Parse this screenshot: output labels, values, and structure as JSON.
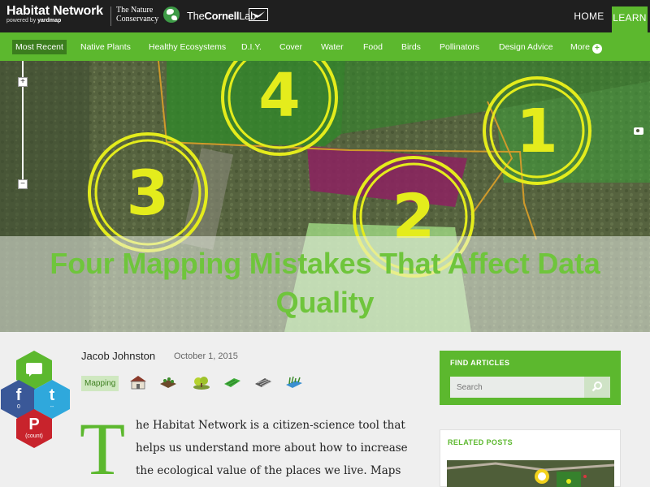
{
  "header": {
    "brand_title": "Habitat Network",
    "brand_sub_prefix": "powered by ",
    "brand_sub_bold": "yardmap",
    "partner1_line1": "The Nature",
    "partner1_line2": "Conservancy",
    "partner2_light": "The",
    "partner2_bold": "Cornell",
    "partner2_tail": "Lab",
    "nav": {
      "home": "HOME",
      "learn": "LEARN"
    }
  },
  "categories": [
    "Most Recent",
    "Native Plants",
    "Healthy Ecosystems",
    "D.I.Y.",
    "Cover",
    "Water",
    "Food",
    "Birds",
    "Pollinators",
    "Design Advice",
    "More"
  ],
  "categories_active": "Most Recent",
  "more_icon_glyph": "+",
  "hero": {
    "title_line1": "Four Mapping Mistakes That Affect Data",
    "title_line2": "Quality",
    "zoom_in": "+",
    "zoom_out": "−",
    "map_numbers": [
      "4",
      "1",
      "3",
      "2"
    ]
  },
  "article": {
    "author": "Jacob Johnston",
    "date": "October 1, 2015",
    "tag": "Mapping",
    "dropcap": "T",
    "paragraph": "he Habitat Network is a citizen-science tool that helps us understand more about how to increase the ecological value of the places we live. Maps"
  },
  "social": {
    "facebook_glyph": "f",
    "facebook_count": "0",
    "twitter_glyph": "t",
    "twitter_count": "--",
    "pinterest_glyph": "P",
    "pinterest_count": "(count)"
  },
  "sidebar": {
    "find_title": "FIND ARTICLES",
    "search_placeholder": "Search",
    "related_title": "RELATED POSTS"
  },
  "colors": {
    "brand_green": "#5cb82e",
    "active_green": "#3b7d1e",
    "header_dark": "#1f1f1f",
    "map_yellow": "#e4ec1c",
    "title_green": "#6fc53c"
  }
}
